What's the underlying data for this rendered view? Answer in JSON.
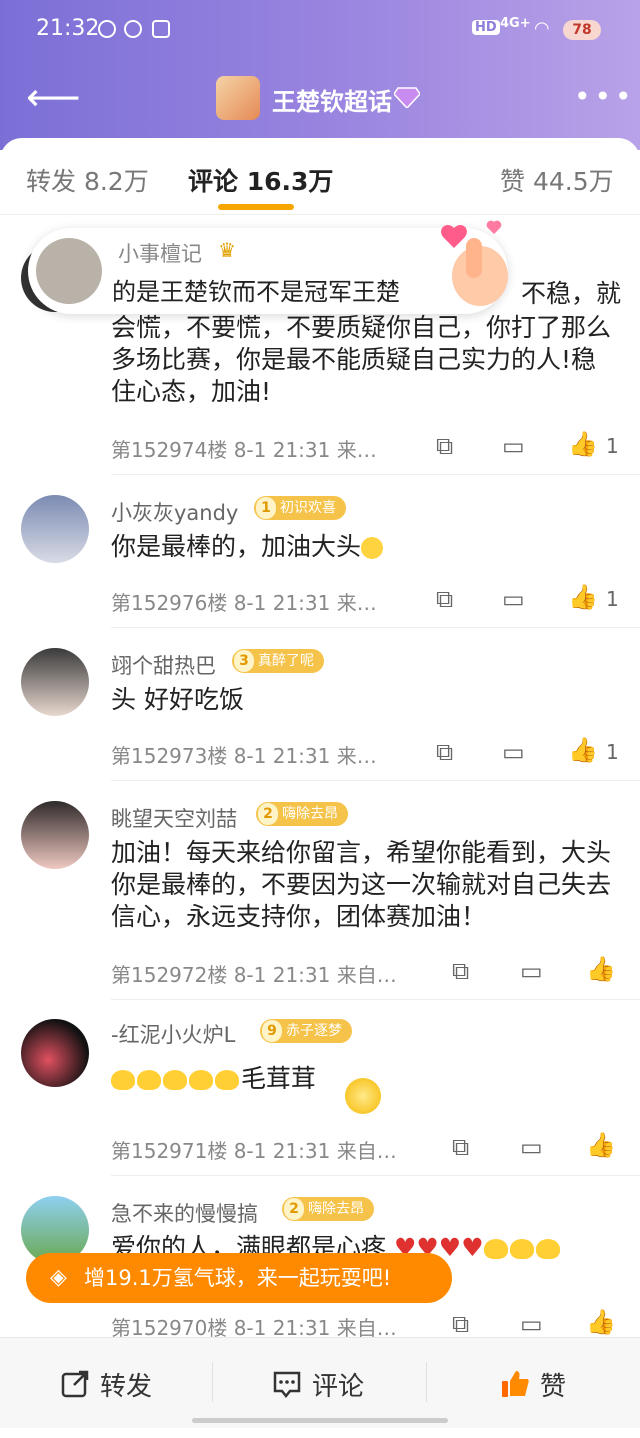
{
  "status": {
    "time": "21:32",
    "battery": "78",
    "hd": "HD",
    "net": "4G+"
  },
  "nav": {
    "topic_title": "王楚钦超话"
  },
  "tabs": [
    {
      "label": "转发 8.2万"
    },
    {
      "label": "评论 16.3万"
    },
    {
      "label": "赞 44.5万"
    }
  ],
  "popup": {
    "name": "小事檀记",
    "text": "的是王楚钦而不是冠军王楚"
  },
  "comments": [
    {
      "name": "",
      "text_line1_end": "不稳，就",
      "text": "会慌，不要慌，不要质疑你自己，你打了那么多场比赛，你是最不能质疑自己实力的人!稳住心态，加油!",
      "meta": "第152974楼  8-1 21:31  来…",
      "likes": "1"
    },
    {
      "name": "小灰灰yandy",
      "badge_level": "1",
      "badge": "初识欢喜",
      "text": "你是最棒的，加油大头",
      "meta": "第152976楼  8-1 21:31  来…",
      "likes": "1"
    },
    {
      "name": "翊个甜热巴",
      "badge_level": "3",
      "badge": "真醉了呢",
      "text": "头 好好吃饭",
      "meta": "第152973楼  8-1 21:31  来…",
      "likes": "1"
    },
    {
      "name": "眺望天空刘喆",
      "badge_level": "2",
      "badge": "嗨除去昂",
      "text": "加油！每天来给你留言，希望你能看到，大头你是最棒的，不要因为这一次输就对自己失去信心，永远支持你，团体赛加油！",
      "meta": "第152972楼  8-1 21:31  来自…",
      "likes": ""
    },
    {
      "name": "-红泥小火炉L",
      "badge_level": "9",
      "badge": "赤子逐梦",
      "text": "毛茸茸",
      "meta": "第152971楼  8-1 21:31  来自…",
      "likes": ""
    },
    {
      "name": "急不来的慢慢搞",
      "badge_level": "2",
      "badge": "嗨除去昂",
      "text": "爱你的人，满眼都是心疼",
      "meta": "第152970楼  8-1 21:31  来自…",
      "likes": ""
    }
  ],
  "banner": {
    "text": "增19.1万氢气球，来一起玩耍吧!"
  },
  "bottom": {
    "repost": "转发",
    "comment": "评论",
    "like": "赞"
  },
  "colors": {
    "accent": "#f7a600",
    "orange": "#ff8a00",
    "header": "#8f7ddc"
  }
}
